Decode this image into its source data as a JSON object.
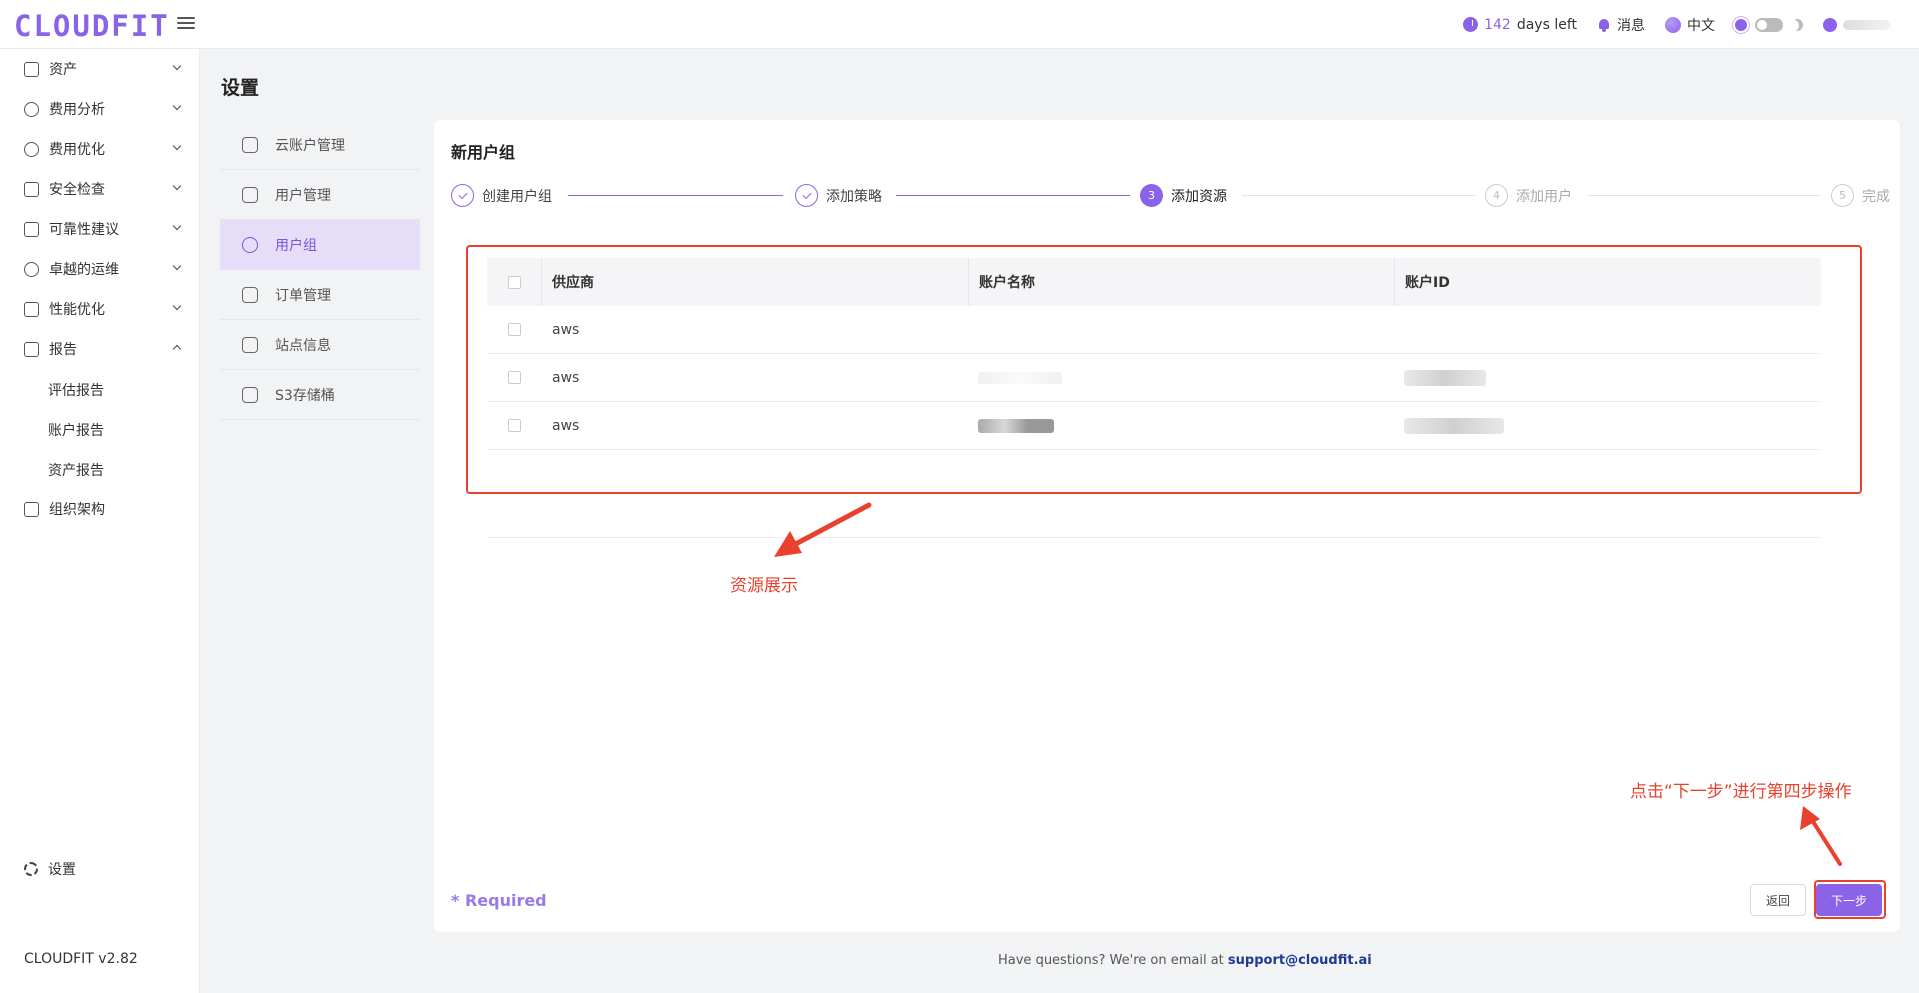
{
  "header": {
    "logo": "CLOUDFIT",
    "days_number": "142",
    "days_suffix": "days left",
    "messages_label": "消息",
    "language_label": "中文"
  },
  "sidebar": {
    "items": [
      {
        "label": "资产",
        "icon": "asset-icon",
        "expanded": false
      },
      {
        "label": "费用分析",
        "icon": "dashboard-icon",
        "expanded": false
      },
      {
        "label": "费用优化",
        "icon": "dollar-icon",
        "expanded": false
      },
      {
        "label": "安全检查",
        "icon": "alarm-icon",
        "expanded": false
      },
      {
        "label": "可靠性建议",
        "icon": "checklist-icon",
        "expanded": false
      },
      {
        "label": "卓越的运维",
        "icon": "cloud-eye-icon",
        "expanded": false
      },
      {
        "label": "性能优化",
        "icon": "board-icon",
        "expanded": false
      },
      {
        "label": "报告",
        "icon": "report-icon",
        "expanded": true
      },
      {
        "label": "组织架构",
        "icon": "org-chart-icon",
        "expanded": false
      }
    ],
    "report_subitems": [
      "评估报告",
      "账户报告",
      "资产报告"
    ],
    "settings_label": "设置",
    "version": "CLOUDFIT v2.82"
  },
  "page": {
    "title": "设置"
  },
  "settings_menu": [
    {
      "label": "云账户管理",
      "icon": "cloud-icon"
    },
    {
      "label": "用户管理",
      "icon": "user-icon"
    },
    {
      "label": "用户组",
      "icon": "user-group-icon",
      "active": true
    },
    {
      "label": "订单管理",
      "icon": "orders-icon"
    },
    {
      "label": "站点信息",
      "icon": "site-info-icon"
    },
    {
      "label": "S3存储桶",
      "icon": "bucket-icon"
    }
  ],
  "panel": {
    "title": "新用户组",
    "steps": [
      {
        "index": "1",
        "label": "创建用户组",
        "status": "done"
      },
      {
        "index": "2",
        "label": "添加策略",
        "status": "done"
      },
      {
        "index": "3",
        "label": "添加资源",
        "status": "current"
      },
      {
        "index": "4",
        "label": "添加用户",
        "status": "todo"
      },
      {
        "index": "5",
        "label": "完成",
        "status": "todo"
      }
    ],
    "table": {
      "columns": [
        "供应商",
        "账户名称",
        "账户ID"
      ],
      "rows": [
        {
          "provider": "aws"
        },
        {
          "provider": "aws"
        },
        {
          "provider": "aws"
        }
      ]
    },
    "required_label": "* Required",
    "back_label": "返回",
    "next_label": "下一步"
  },
  "annotations": {
    "resource_note": "资源展示",
    "next_step_note": "点击“下一步”进行第四步操作"
  },
  "footer": {
    "text": "Have questions? We're on email at",
    "email": "support@cloudfit.ai"
  },
  "colors": {
    "accent": "#8b63e8",
    "annotation": "#e8412e",
    "active_menu_bg": "#e6ddf9"
  }
}
